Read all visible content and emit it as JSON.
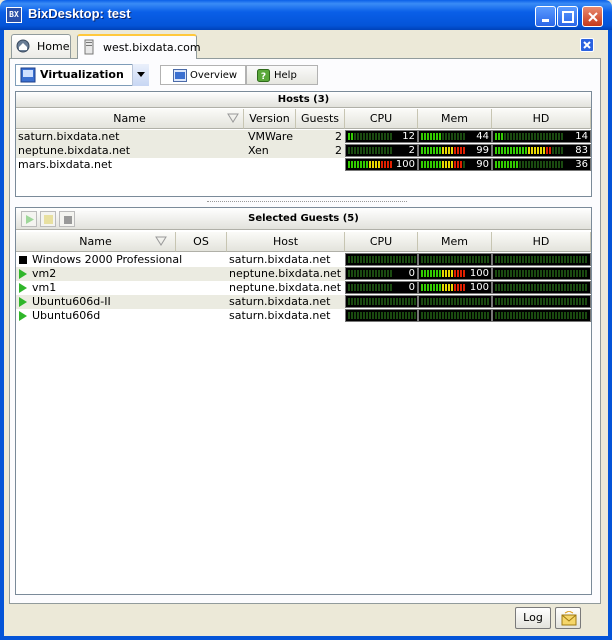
{
  "window": {
    "title": "BixDesktop: test",
    "app_icon_text": "BX"
  },
  "tabs": [
    {
      "label": "Home",
      "icon": "home-icon"
    },
    {
      "label": "west.bixdata.com",
      "icon": "server-icon"
    }
  ],
  "toolbar": {
    "combo_value": "Virtualization",
    "overview_label": "Overview",
    "help_label": "Help"
  },
  "hosts": {
    "title": "Hosts (3)",
    "columns": [
      "Name",
      "Version",
      "Guests",
      "CPU",
      "Mem",
      "HD"
    ],
    "rows": [
      {
        "name": "saturn.bixdata.net",
        "version": "VMWare",
        "guests": "2",
        "cpu": 12,
        "mem": 44,
        "hd": 14
      },
      {
        "name": "neptune.bixdata.net",
        "version": "Xen",
        "guests": "2",
        "cpu": 2,
        "mem": 99,
        "hd": 83
      },
      {
        "name": "mars.bixdata.net",
        "version": "",
        "guests": "",
        "cpu": 100,
        "mem": 90,
        "hd": 36
      }
    ]
  },
  "guests": {
    "title": "Selected Guests (5)",
    "columns": [
      "Name",
      "OS",
      "Host",
      "CPU",
      "Mem",
      "HD"
    ],
    "rows": [
      {
        "name": "Windows 2000 Professional",
        "status": "stopped",
        "os": "",
        "host": "saturn.bixdata.net",
        "cpu": null,
        "mem": null,
        "hd": null
      },
      {
        "name": "vm2",
        "status": "running",
        "os": "",
        "host": "neptune.bixdata.net",
        "cpu": 0,
        "mem": 100,
        "hd": null
      },
      {
        "name": "vm1",
        "status": "running",
        "os": "",
        "host": "neptune.bixdata.net",
        "cpu": 0,
        "mem": 100,
        "hd": null
      },
      {
        "name": "Ubuntu606d-II",
        "status": "running",
        "os": "",
        "host": "saturn.bixdata.net",
        "cpu": null,
        "mem": null,
        "hd": null
      },
      {
        "name": "Ubuntu606d",
        "status": "running",
        "os": "",
        "host": "saturn.bixdata.net",
        "cpu": null,
        "mem": null,
        "hd": null
      }
    ]
  },
  "footer": {
    "log_label": "Log"
  },
  "colors": {
    "title_blue": "#0454d8",
    "meter_green": "#33cc00",
    "meter_yellow": "#e8d800",
    "meter_red": "#e02000",
    "meter_off": "#1a4a10"
  }
}
